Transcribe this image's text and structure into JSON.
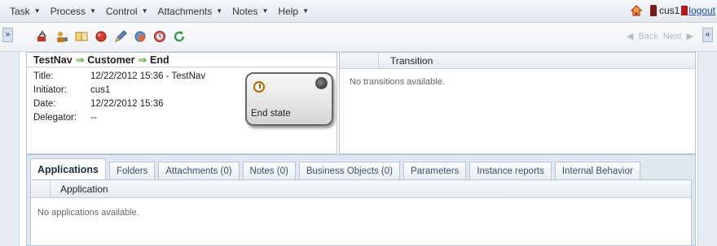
{
  "menu": {
    "items": [
      "Task",
      "Process",
      "Control",
      "Attachments",
      "Notes",
      "Help"
    ]
  },
  "user": {
    "name": "cus1",
    "logout": "logout"
  },
  "toolbar": {
    "expand_left": "»",
    "collapse_right": "«",
    "back_label": "Back",
    "next_label": "Next"
  },
  "info": {
    "flow": [
      "TestNav",
      "Customer",
      "End"
    ],
    "rows": [
      {
        "label": "Title:",
        "value": "12/22/2012 15:36 - TestNav"
      },
      {
        "label": "Initiator:",
        "value": "cus1"
      },
      {
        "label": "Date:",
        "value": "12/22/2012 15:36"
      },
      {
        "label": "Delegator:",
        "value": "--"
      }
    ],
    "state_label": "End state"
  },
  "transition": {
    "header": "Transition",
    "empty": "No transitions available."
  },
  "tabs": {
    "items": [
      "Applications",
      "Folders",
      "Attachments (0)",
      "Notes (0)",
      "Business Objects (0)",
      "Parameters",
      "Instance reports",
      "Internal Behavior"
    ],
    "active": "Applications"
  },
  "applications": {
    "header": "Application",
    "empty": "No applications available."
  },
  "icons": [
    "task-icon",
    "user-icon",
    "book-icon",
    "record-icon",
    "pen-icon",
    "gear-icon",
    "clock-icon",
    "refresh-icon"
  ]
}
